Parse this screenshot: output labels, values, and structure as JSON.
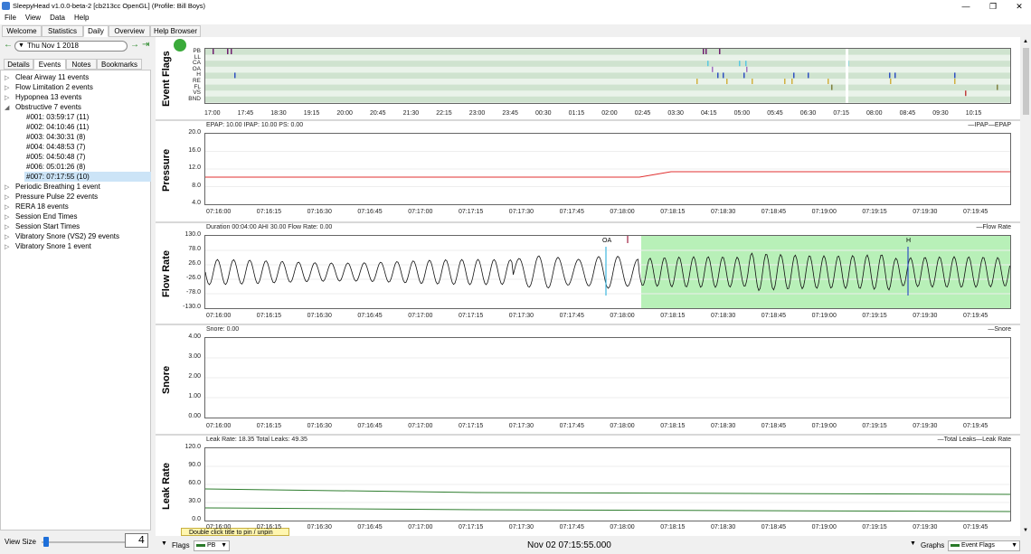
{
  "window": {
    "title": "SleepyHead v1.0.0-beta-2 [cb213cc OpenGL] (Profile: Bill Boys)"
  },
  "menu": [
    "File",
    "View",
    "Data",
    "Help"
  ],
  "tabs": [
    "Welcome",
    "Statistics",
    "Daily",
    "Overview",
    "Help Browser"
  ],
  "active_tab": "Daily",
  "date": "Thu Nov 1 2018",
  "left_tabs": [
    "Details",
    "Events",
    "Notes",
    "Bookmarks"
  ],
  "active_left_tab": "Events",
  "events": [
    "Clear Airway 11 events",
    "Flow Limitation 2 events",
    "Hypopnea 13 events",
    "Obstructive 7 events",
    "Periodic Breathing 1 event",
    "Pressure Pulse 22 events",
    "RERA 18 events",
    "Session End Times",
    "Session Start Times",
    "Vibratory Snore (VS2)  29 events",
    "Vibratory Snore 1 event"
  ],
  "obstructive_children": [
    "#001: 03:59:17 (11)",
    "#002: 04:10:46 (11)",
    "#003: 04:30:31 (8)",
    "#004: 04:48:53 (7)",
    "#005: 04:50:48 (7)",
    "#006: 05:01:26 (8)",
    "#007: 07:17:55 (10)"
  ],
  "selected_child": "#007: 07:17:55 (10)",
  "view_size": {
    "label": "View Size",
    "value": "4"
  },
  "event_flags": {
    "title": "Event Flags",
    "rows": [
      "PB",
      "LL",
      "CA",
      "OA",
      "H",
      "RE",
      "FL",
      "VS",
      "BND"
    ],
    "time_ticks": [
      "17:00",
      "17:45",
      "18:30",
      "19:15",
      "20:00",
      "20:45",
      "21:30",
      "22:15",
      "23:00",
      "23:45",
      "00:30",
      "01:15",
      "02:00",
      "02:45",
      "03:30",
      "04:15",
      "05:00",
      "05:45",
      "06:30",
      "07:15",
      "08:00",
      "08:45",
      "09:30",
      "10:15"
    ]
  },
  "time_ticks": [
    "07:16:00",
    "07:16:15",
    "07:16:30",
    "07:16:45",
    "07:17:00",
    "07:17:15",
    "07:17:30",
    "07:17:45",
    "07:18:00",
    "07:18:15",
    "07:18:30",
    "07:18:45",
    "07:19:00",
    "07:19:15",
    "07:19:30",
    "07:19:45"
  ],
  "pressure": {
    "title": "Pressure",
    "header": "EPAP: 10.00 IPAP: 10.00 PS: 0.00",
    "legend": "IPAP—EPAP",
    "yticks": [
      "20.0",
      "16.0",
      "12.0",
      "8.0",
      "4.0"
    ],
    "color": "#e03030"
  },
  "flow": {
    "title": "Flow Rate",
    "header": "Duration 00:04:00 AHI 30.00 Flow Rate: 0.00",
    "legend": "Flow Rate",
    "yticks": [
      "130.0",
      "78.0",
      "26.0",
      "-26.0",
      "-78.0",
      "-130.0"
    ],
    "markers": [
      "OA",
      "H"
    ],
    "highlight_color": "#b8f0b8"
  },
  "snore": {
    "title": "Snore",
    "header": "Snore: 0.00",
    "legend": "Snore",
    "yticks": [
      "4.00",
      "3.00",
      "2.00",
      "1.00",
      "0.00"
    ]
  },
  "leak": {
    "title": "Leak Rate",
    "header": "Leak Rate: 18.35 Total Leaks: 49.35",
    "legend": "Total Leaks—Leak Rate",
    "yticks": [
      "120.0",
      "90.0",
      "60.0",
      "30.0",
      "0.0"
    ],
    "tooltip": "Double click title to pin / unpin",
    "color": "#2e7d2e"
  },
  "bottom": {
    "flags_label": "Flags",
    "flags_combo": "PB",
    "datetime": "Nov 02 07:15:55.000",
    "graphs_label": "Graphs",
    "graphs_combo": "Event Flags"
  }
}
